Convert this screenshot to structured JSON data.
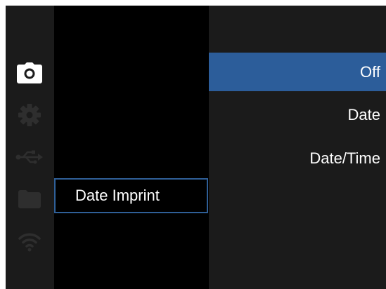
{
  "sidebar": {
    "icons": [
      {
        "name": "camera-icon",
        "active": true,
        "color": "#ffffff"
      },
      {
        "name": "gear-icon",
        "active": false,
        "color": "#2e2e2e"
      },
      {
        "name": "usb-icon",
        "active": false,
        "color": "#2e2e2e"
      },
      {
        "name": "folder-icon",
        "active": false,
        "color": "#2e2e2e"
      },
      {
        "name": "wifi-icon",
        "active": false,
        "color": "#2e2e2e"
      }
    ]
  },
  "menu": {
    "current_setting": "Date Imprint"
  },
  "options": {
    "items": [
      {
        "label": "Off",
        "selected": true
      },
      {
        "label": "Date",
        "selected": false
      },
      {
        "label": "Date/Time",
        "selected": false
      }
    ]
  },
  "colors": {
    "accent": "#2c5d9a",
    "panel": "#1b1b1b",
    "background": "#000000",
    "inactive_icon": "#2e2e2e"
  }
}
